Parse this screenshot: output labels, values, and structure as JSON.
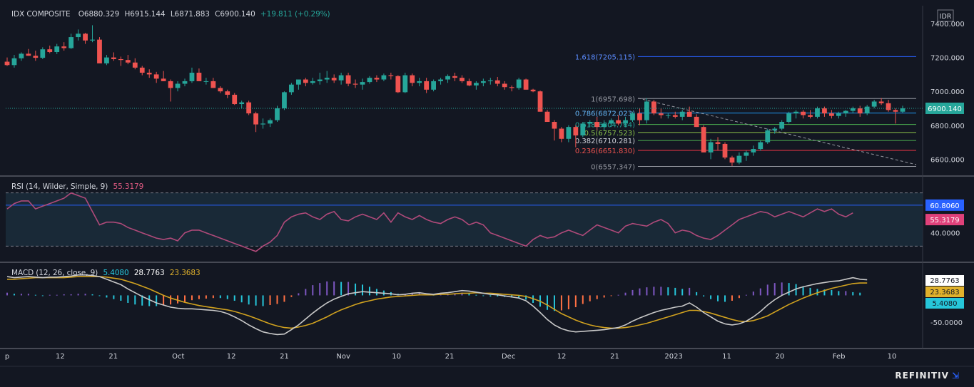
{
  "header": {
    "symbol": "IDX COMPOSITE",
    "open": "O6880.329",
    "high": "H6915.144",
    "low": "L6871.883",
    "close": "C6900.140",
    "change": "+19.811 (+0.29%)",
    "currency": "IDR"
  },
  "rsi_legend": {
    "label": "RSI (14, Wilder, Simple, 9)",
    "value": "55.3179"
  },
  "macd_legend": {
    "label": "MACD (12, 26, close, 9)",
    "v1": "5.4080",
    "v2": "28.7763",
    "v3": "23.3683"
  },
  "brand": "REFINITIV",
  "colors": {
    "background": "#131722",
    "up": "#26a69a",
    "down": "#ef5350",
    "rsi": "#b04a7a",
    "signal": "#d1a21f",
    "macd": "#c8c8c8",
    "fib_1618": "#2962ff"
  },
  "chart_data": [
    {
      "type": "candlestick",
      "title": "IDX COMPOSITE",
      "ylim": [
        6530,
        7480
      ],
      "yticks": [
        "7400.000",
        "7200.000",
        "7000.000",
        "6800.000",
        "6600.000"
      ],
      "last_price_label": "6900.140",
      "xticks": [
        "p",
        "12",
        "21",
        "Oct",
        "12",
        "21",
        "Nov",
        "10",
        "21",
        "Dec",
        "12",
        "21",
        "2023",
        "11",
        "20",
        "Feb",
        "10"
      ],
      "fibonacci": [
        {
          "label": "1.618(7205.115)",
          "value": 7205.115
        },
        {
          "label": "1(6957.698)",
          "value": 6957.698
        },
        {
          "label": "0.786(6872.023)",
          "value": 6872.023
        },
        {
          "label": "0.618(6804.764)",
          "value": 6804.764
        },
        {
          "label": "0.5(6757.523)",
          "value": 6757.523
        },
        {
          "label": "0.382(6710.281)",
          "value": 6710.281
        },
        {
          "label": "0.236(6651.830)",
          "value": 6651.83
        },
        {
          "label": "0(6557.347)",
          "value": 6557.347
        }
      ],
      "trendline": {
        "from": 6960,
        "to": 6568
      },
      "ohlc": [
        [
          7175,
          7200,
          7150,
          7155
        ],
        [
          7155,
          7215,
          7140,
          7195
        ],
        [
          7195,
          7230,
          7180,
          7222
        ],
        [
          7222,
          7250,
          7210,
          7210
        ],
        [
          7210,
          7240,
          7180,
          7198
        ],
        [
          7198,
          7260,
          7190,
          7248
        ],
        [
          7248,
          7270,
          7225,
          7232
        ],
        [
          7232,
          7280,
          7220,
          7265
        ],
        [
          7265,
          7290,
          7240,
          7255
        ],
        [
          7255,
          7340,
          7250,
          7320
        ],
        [
          7320,
          7365,
          7300,
          7340
        ],
        [
          7340,
          7345,
          7280,
          7300
        ],
        [
          7300,
          7390,
          7290,
          7305
        ],
        [
          7305,
          7320,
          7220,
          7165
        ],
        [
          7165,
          7215,
          7155,
          7200
        ],
        [
          7200,
          7230,
          7180,
          7190
        ],
        [
          7190,
          7205,
          7150,
          7185
        ],
        [
          7185,
          7215,
          7160,
          7170
        ],
        [
          7170,
          7195,
          7130,
          7140
        ],
        [
          7140,
          7150,
          7095,
          7110
        ],
        [
          7110,
          7130,
          7080,
          7100
        ],
        [
          7100,
          7115,
          7050,
          7075
        ],
        [
          7075,
          7120,
          7060,
          7060
        ],
        [
          7060,
          7070,
          6940,
          7020
        ],
        [
          7020,
          7060,
          7000,
          7045
        ],
        [
          7045,
          7075,
          7030,
          7060
        ],
        [
          7060,
          7140,
          7050,
          7110
        ],
        [
          7110,
          7135,
          7090,
          7060
        ],
        [
          7060,
          7080,
          7040,
          7060
        ],
        [
          7060,
          7080,
          7020,
          7020
        ],
        [
          7020,
          7030,
          6990,
          7000
        ],
        [
          7000,
          7010,
          6960,
          6980
        ],
        [
          6980,
          6990,
          6920,
          6925
        ],
        [
          6925,
          6945,
          6900,
          6935
        ],
        [
          6935,
          6945,
          6860,
          6870
        ],
        [
          6870,
          6880,
          6760,
          6805
        ],
        [
          6805,
          6840,
          6780,
          6810
        ],
        [
          6810,
          6840,
          6790,
          6830
        ],
        [
          6830,
          6915,
          6820,
          6900
        ],
        [
          6900,
          7000,
          6890,
          6995
        ],
        [
          6995,
          7050,
          6980,
          7040
        ],
        [
          7040,
          7060,
          7010,
          7070
        ],
        [
          7070,
          7080,
          7030,
          7050
        ],
        [
          7050,
          7080,
          7040,
          7060
        ],
        [
          7060,
          7110,
          7040,
          7070
        ],
        [
          7070,
          7120,
          7050,
          7080
        ],
        [
          7080,
          7100,
          7050,
          7065
        ],
        [
          7065,
          7110,
          7040,
          7095
        ],
        [
          7095,
          7110,
          7030,
          7045
        ],
        [
          7045,
          7070,
          7020,
          7040
        ],
        [
          7040,
          7075,
          7010,
          7055
        ],
        [
          7055,
          7090,
          7045,
          7080
        ],
        [
          7080,
          7095,
          7055,
          7070
        ],
        [
          7070,
          7105,
          7060,
          7095
        ],
        [
          7095,
          7110,
          7070,
          7090
        ],
        [
          7090,
          7095,
          6990,
          6995
        ],
        [
          6995,
          7110,
          6990,
          7095
        ],
        [
          7095,
          7105,
          7030,
          7050
        ],
        [
          7050,
          7080,
          7030,
          7060
        ],
        [
          7060,
          7080,
          6990,
          7010
        ],
        [
          7010,
          7070,
          7000,
          7060
        ],
        [
          7060,
          7080,
          7040,
          7070
        ],
        [
          7070,
          7100,
          7050,
          7090
        ],
        [
          7090,
          7110,
          7060,
          7080
        ],
        [
          7080,
          7095,
          7050,
          7060
        ],
        [
          7060,
          7075,
          7030,
          7035
        ],
        [
          7035,
          7060,
          7010,
          7050
        ],
        [
          7050,
          7075,
          7030,
          7060
        ],
        [
          7060,
          7080,
          7040,
          7065
        ],
        [
          7065,
          7085,
          7030,
          7045
        ],
        [
          7045,
          7060,
          7010,
          7025
        ],
        [
          7025,
          7035,
          7000,
          7020
        ],
        [
          7020,
          7080,
          7010,
          7070
        ],
        [
          7070,
          7075,
          7010,
          7010
        ],
        [
          7010,
          7015,
          6995,
          7000
        ],
        [
          7000,
          7005,
          6880,
          6880
        ],
        [
          6880,
          6890,
          6820,
          6820
        ],
        [
          6820,
          6830,
          6710,
          6780
        ],
        [
          6780,
          6790,
          6700,
          6720
        ],
        [
          6720,
          6800,
          6700,
          6790
        ],
        [
          6790,
          6800,
          6670,
          6740
        ],
        [
          6740,
          6820,
          6730,
          6810
        ],
        [
          6810,
          6830,
          6790,
          6820
        ],
        [
          6820,
          6850,
          6770,
          6790
        ],
        [
          6790,
          6830,
          6770,
          6810
        ],
        [
          6810,
          6840,
          6790,
          6830
        ],
        [
          6830,
          6860,
          6800,
          6810
        ],
        [
          6810,
          6850,
          6790,
          6830
        ],
        [
          6830,
          6880,
          6820,
          6870
        ],
        [
          6870,
          6900,
          6800,
          6830
        ],
        [
          6830,
          6960,
          6810,
          6940
        ],
        [
          6940,
          6950,
          6860,
          6870
        ],
        [
          6870,
          6900,
          6840,
          6860
        ],
        [
          6860,
          6870,
          6840,
          6860
        ],
        [
          6860,
          6880,
          6840,
          6850
        ],
        [
          6850,
          6890,
          6830,
          6880
        ],
        [
          6880,
          6910,
          6860,
          6850
        ],
        [
          6850,
          6865,
          6790,
          6790
        ],
        [
          6790,
          6800,
          6700,
          6640
        ],
        [
          6640,
          6720,
          6600,
          6700
        ],
        [
          6700,
          6730,
          6650,
          6690
        ],
        [
          6690,
          6700,
          6600,
          6610
        ],
        [
          6610,
          6620,
          6560,
          6580
        ],
        [
          6580,
          6640,
          6570,
          6620
        ],
        [
          6620,
          6650,
          6590,
          6640
        ],
        [
          6640,
          6680,
          6620,
          6660
        ],
        [
          6660,
          6710,
          6650,
          6700
        ],
        [
          6700,
          6780,
          6690,
          6770
        ],
        [
          6770,
          6790,
          6750,
          6780
        ],
        [
          6780,
          6830,
          6770,
          6820
        ],
        [
          6820,
          6880,
          6810,
          6870
        ],
        [
          6870,
          6890,
          6840,
          6880
        ],
        [
          6880,
          6890,
          6840,
          6860
        ],
        [
          6860,
          6890,
          6840,
          6850
        ],
        [
          6850,
          6910,
          6840,
          6900
        ],
        [
          6900,
          6910,
          6850,
          6870
        ],
        [
          6870,
          6890,
          6840,
          6855
        ],
        [
          6855,
          6880,
          6840,
          6870
        ],
        [
          6870,
          6890,
          6850,
          6885
        ],
        [
          6885,
          6910,
          6870,
          6900
        ],
        [
          6900,
          6915,
          6850,
          6870
        ],
        [
          6870,
          6920,
          6860,
          6910
        ],
        [
          6910,
          6950,
          6900,
          6940
        ],
        [
          6940,
          6960,
          6920,
          6930
        ],
        [
          6930,
          6950,
          6880,
          6890
        ],
        [
          6890,
          6900,
          6810,
          6880
        ],
        [
          6880,
          6915,
          6872,
          6900
        ]
      ]
    },
    {
      "type": "line",
      "title": "RSI (14, Wilder, Simple, 9)",
      "ylim": [
        20,
        80
      ],
      "yticks": [
        "40.0000"
      ],
      "bands": [
        70,
        30
      ],
      "labels": [
        "60.8060",
        "55.3179"
      ],
      "signal_line": 60.806,
      "values": [
        58,
        62,
        64,
        64,
        58,
        60,
        62,
        64,
        66,
        70,
        68,
        66,
        56,
        46,
        48,
        48,
        47,
        44,
        42,
        40,
        38,
        36,
        35,
        36,
        34,
        40,
        42,
        42,
        40,
        38,
        36,
        34,
        32,
        30,
        28,
        26,
        30,
        33,
        38,
        48,
        52,
        54,
        55,
        52,
        50,
        54,
        56,
        50,
        49,
        52,
        54,
        52,
        50,
        55,
        48,
        55,
        52,
        50,
        53,
        50,
        48,
        47,
        50,
        52,
        50,
        46,
        48,
        46,
        40,
        38,
        36,
        34,
        32,
        30,
        35,
        38,
        36,
        37,
        40,
        42,
        40,
        38,
        42,
        46,
        44,
        42,
        40,
        45,
        47,
        46,
        45,
        48,
        50,
        47,
        40,
        42,
        41,
        38,
        36,
        35,
        38,
        42,
        46,
        50,
        52,
        54,
        56,
        55,
        52,
        54,
        56,
        54,
        52,
        55,
        58,
        56,
        58,
        54,
        52,
        55
      ]
    },
    {
      "type": "line",
      "title": "MACD (12, 26, close, 9)",
      "ylim": [
        -95,
        55
      ],
      "yticks": [
        "-50.0000"
      ],
      "labels": [
        "28.7763",
        "23.3683",
        "5.4080"
      ],
      "macd": [
        35,
        33,
        34,
        35,
        34,
        33,
        34,
        34,
        35,
        36,
        38,
        38,
        37,
        35,
        30,
        25,
        20,
        12,
        5,
        -2,
        -8,
        -14,
        -18,
        -22,
        -24,
        -25,
        -25,
        -26,
        -27,
        -28,
        -30,
        -34,
        -40,
        -47,
        -55,
        -62,
        -68,
        -71,
        -73,
        -72,
        -64,
        -55,
        -44,
        -33,
        -23,
        -14,
        -7,
        -2,
        3,
        5,
        7,
        6,
        5,
        4,
        3,
        1,
        2,
        4,
        5,
        3,
        2,
        4,
        5,
        7,
        9,
        8,
        6,
        4,
        2,
        1,
        -1,
        -3,
        -5,
        -10,
        -20,
        -32,
        -45,
        -55,
        -62,
        -66,
        -68,
        -67,
        -66,
        -65,
        -64,
        -62,
        -60,
        -55,
        -48,
        -42,
        -37,
        -32,
        -28,
        -25,
        -22,
        -20,
        -14,
        -22,
        -32,
        -40,
        -48,
        -53,
        -55,
        -53,
        -48,
        -40,
        -30,
        -18,
        -8,
        0,
        6,
        12,
        16,
        19,
        22,
        24,
        26,
        27,
        30,
        33,
        30,
        29
      ],
      "signal": [
        30,
        30,
        31,
        32,
        33,
        33,
        33,
        33,
        33,
        34,
        35,
        35,
        35,
        35,
        34,
        32,
        30,
        26,
        22,
        17,
        12,
        6,
        0,
        -5,
        -9,
        -13,
        -16,
        -19,
        -21,
        -23,
        -25,
        -27,
        -30,
        -34,
        -38,
        -43,
        -48,
        -53,
        -57,
        -60,
        -61,
        -59,
        -56,
        -52,
        -46,
        -40,
        -33,
        -27,
        -22,
        -17,
        -13,
        -10,
        -7,
        -5,
        -3,
        -2,
        -1,
        0,
        1,
        1,
        1,
        2,
        2,
        3,
        4,
        4,
        5,
        4,
        4,
        3,
        2,
        1,
        0,
        -2,
        -6,
        -11,
        -18,
        -26,
        -34,
        -40,
        -46,
        -51,
        -55,
        -58,
        -60,
        -61,
        -61,
        -60,
        -58,
        -55,
        -52,
        -48,
        -44,
        -40,
        -36,
        -32,
        -28,
        -28,
        -30,
        -33,
        -37,
        -41,
        -45,
        -48,
        -49,
        -47,
        -43,
        -38,
        -31,
        -24,
        -17,
        -11,
        -5,
        0,
        5,
        9,
        13,
        16,
        19,
        22,
        23,
        23
      ],
      "histogram": [
        5,
        3,
        3,
        3,
        1,
        0,
        1,
        1,
        2,
        2,
        3,
        3,
        2,
        0,
        -4,
        -7,
        -10,
        -14,
        -17,
        -19,
        -20,
        -20,
        -18,
        -17,
        -15,
        -12,
        -9,
        -7,
        -6,
        -5,
        -5,
        -7,
        -10,
        -13,
        -17,
        -19,
        -20,
        -18,
        -16,
        -12,
        -3,
        4,
        12,
        19,
        23,
        26,
        26,
        25,
        25,
        22,
        20,
        16,
        12,
        9,
        6,
        3,
        3,
        4,
        4,
        2,
        1,
        2,
        3,
        4,
        5,
        4,
        1,
        0,
        -2,
        -2,
        -3,
        -4,
        -5,
        -8,
        -14,
        -21,
        -27,
        -29,
        -28,
        -26,
        -22,
        -16,
        -11,
        -7,
        -4,
        -1,
        1,
        5,
        10,
        13,
        15,
        16,
        16,
        15,
        14,
        12,
        14,
        6,
        -2,
        -7,
        -11,
        -12,
        -10,
        -5,
        1,
        7,
        13,
        20,
        23,
        24,
        23,
        21,
        17,
        14,
        12,
        11,
        10,
        8,
        8,
        6,
        5
      ]
    }
  ]
}
